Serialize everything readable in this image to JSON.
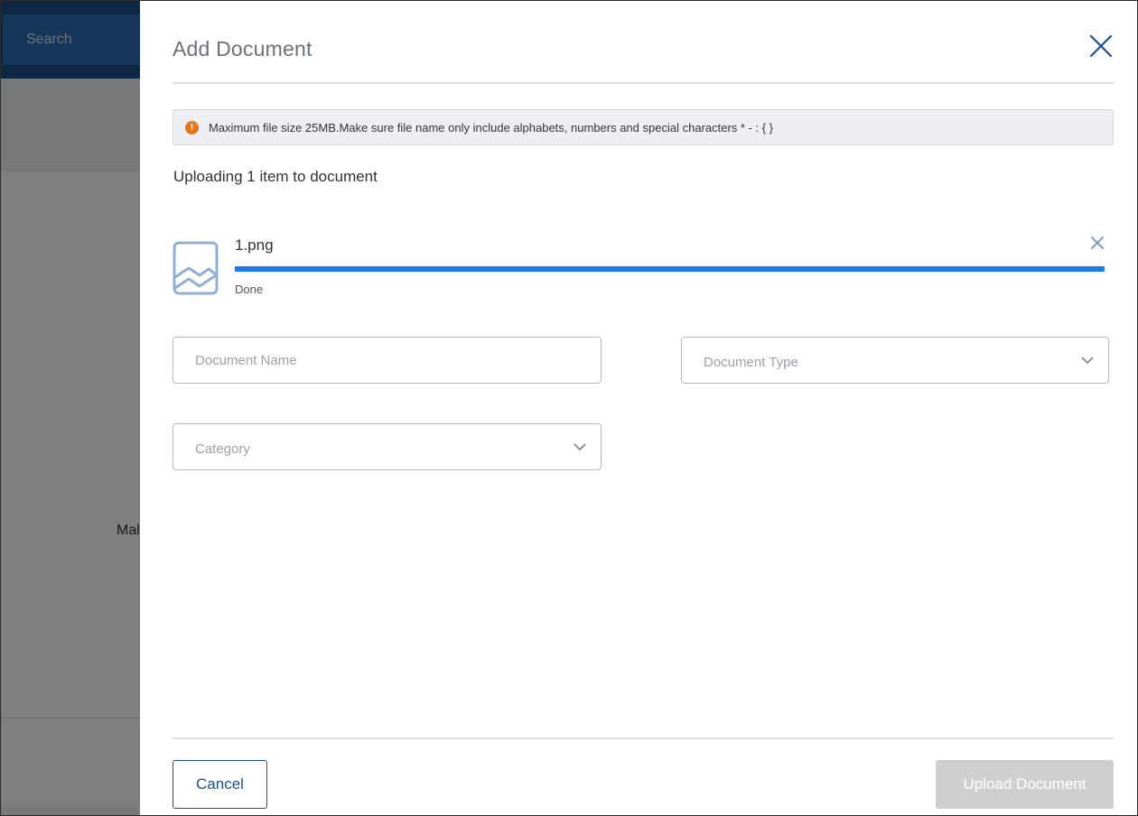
{
  "background": {
    "search_label": "Search",
    "partial_text": "Mal"
  },
  "drawer": {
    "title": "Add Document",
    "close_icon": "close-icon",
    "notice": {
      "icon": "alert-icon",
      "icon_glyph": "!",
      "text": "Maximum file size 25MB.Make sure file name only include alphabets, numbers and special characters * - : { }"
    },
    "upload_heading": "Uploading 1 item to document",
    "file": {
      "icon": "image-file-icon",
      "name": "1.png",
      "progress_percent": 100,
      "status": "Done",
      "remove_icon": "close-icon"
    },
    "fields": {
      "document_name_placeholder": "Document Name",
      "document_type_placeholder": "Document Type",
      "category_placeholder": "Category"
    },
    "footer": {
      "cancel_label": "Cancel",
      "upload_label": "Upload Document"
    }
  },
  "colors": {
    "accent": "#1d4f86",
    "progress": "#1e7ae6",
    "warning": "#e8751a",
    "disabled": "#cfcfcf"
  }
}
